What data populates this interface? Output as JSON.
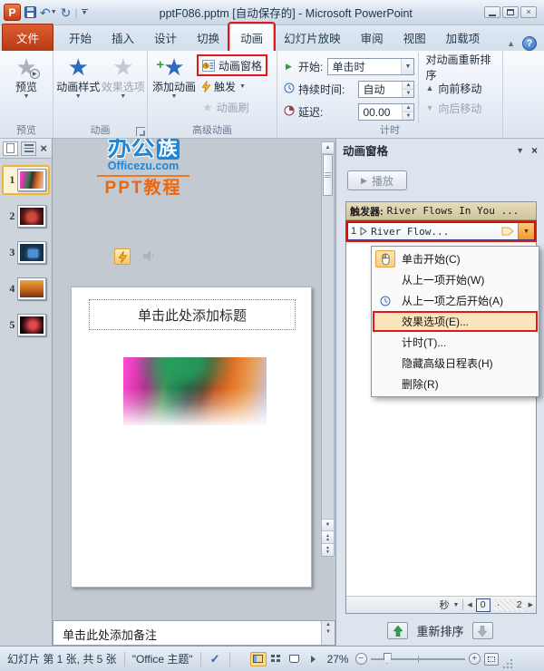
{
  "colors": {
    "annotation_red": "#e41616",
    "file_tab_orange": "#c7431f",
    "accent_blue": "#2e6cc0",
    "accent_orange": "#f07a1a",
    "logo_blue": "#1d86d6"
  },
  "titlebar": {
    "title": "pptF086.pptm [自动保存的] - Microsoft PowerPoint",
    "app_icon_letter": "P"
  },
  "tabs": {
    "file": "文件",
    "items": [
      "开始",
      "插入",
      "设计",
      "切换",
      "动画",
      "幻灯片放映",
      "审阅",
      "视图",
      "加载项"
    ]
  },
  "ribbon": {
    "preview_group": {
      "label": "预览",
      "preview_button": "预览"
    },
    "animation_group": {
      "label": "动画",
      "styles_button": "动画样式",
      "effect_options_button": "效果选项"
    },
    "advanced_group": {
      "label": "高级动画",
      "add_animation_button": "添加动画",
      "animation_pane_button": "动画窗格",
      "trigger_button": "触发",
      "painter_button": "动画刷"
    },
    "timing_group": {
      "label": "计时",
      "start_label": "开始:",
      "start_value": "单击时",
      "duration_label": "持续时间:",
      "duration_value": "自动",
      "delay_label": "延迟:",
      "delay_value": "00.00",
      "reorder_title": "对动画重新排序",
      "move_earlier": "向前移动",
      "move_later": "向后移动"
    }
  },
  "slide_panel": {
    "slide_numbers": [
      "1",
      "2",
      "3",
      "4",
      "5"
    ]
  },
  "canvas": {
    "watermark": {
      "brand_main": "办公",
      "brand_badge": "族",
      "site": "Officezu.com",
      "tagline": "PPT教程"
    },
    "slide_title_placeholder": "单击此处添加标题"
  },
  "animation_pane": {
    "title": "动画窗格",
    "play_button": "播放",
    "trigger_prefix": "触发器:",
    "trigger_name": "River Flows In You ...",
    "item_index": "1",
    "item_name": "River Flow...",
    "menu_items": [
      {
        "label": "单击开始(C)"
      },
      {
        "label": "从上一项开始(W)"
      },
      {
        "label": "从上一项之后开始(A)"
      },
      {
        "label": "效果选项(E)..."
      },
      {
        "label": "计时(T)..."
      },
      {
        "label": "隐藏高级日程表(H)"
      },
      {
        "label": "删除(R)"
      }
    ],
    "timeline": {
      "unit": "秒",
      "tick_start": "0",
      "tick_end": "2"
    },
    "reorder_label": "重新排序"
  },
  "notes": {
    "placeholder": "单击此处添加备注"
  },
  "status_bar": {
    "slide_info": "幻灯片 第 1 张, 共 5 张",
    "theme": "\"Office 主题\"",
    "zoom_level": "27%"
  }
}
